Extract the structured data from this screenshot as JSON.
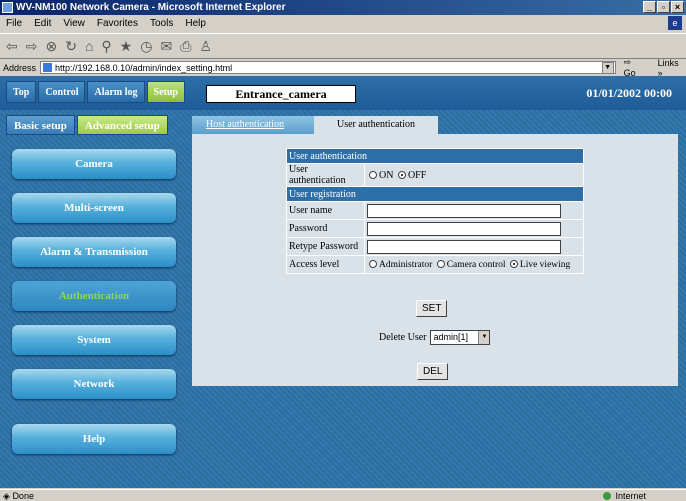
{
  "window": {
    "title": "WV-NM100 Network Camera - Microsoft Internet Explorer"
  },
  "menu": [
    "File",
    "Edit",
    "View",
    "Favorites",
    "Tools",
    "Help"
  ],
  "address": {
    "label": "Address",
    "url": "http://192.168.0.10/admin/index_setting.html",
    "go": "Go",
    "links": "Links"
  },
  "header": {
    "tabs": [
      "Top",
      "Control",
      "Alarm log",
      "Setup"
    ],
    "camera_name": "Entrance_camera",
    "datetime": "01/01/2002  00:00"
  },
  "setup_tabs": [
    "Basic setup",
    "Advanced setup"
  ],
  "nav": [
    "Camera",
    "Multi-screen",
    "Alarm & Transmission",
    "Authentication",
    "System",
    "Network",
    "Help"
  ],
  "subtabs": [
    "Host authentication",
    "User authentication"
  ],
  "form": {
    "section_auth": "User authentication",
    "auth_label": "User authentication",
    "auth_on": "ON",
    "auth_off": "OFF",
    "section_reg": "User registration",
    "username_label": "User name",
    "password_label": "Password",
    "retype_label": "Retype Password",
    "access_label": "Access level",
    "access_admin": "Administrator",
    "access_camera": "Camera control",
    "access_live": "Live viewing",
    "set_button": "SET",
    "delete_label": "Delete User",
    "delete_value": "admin[1]",
    "del_button": "DEL"
  },
  "status": {
    "left": "Done",
    "zone": "Internet"
  }
}
